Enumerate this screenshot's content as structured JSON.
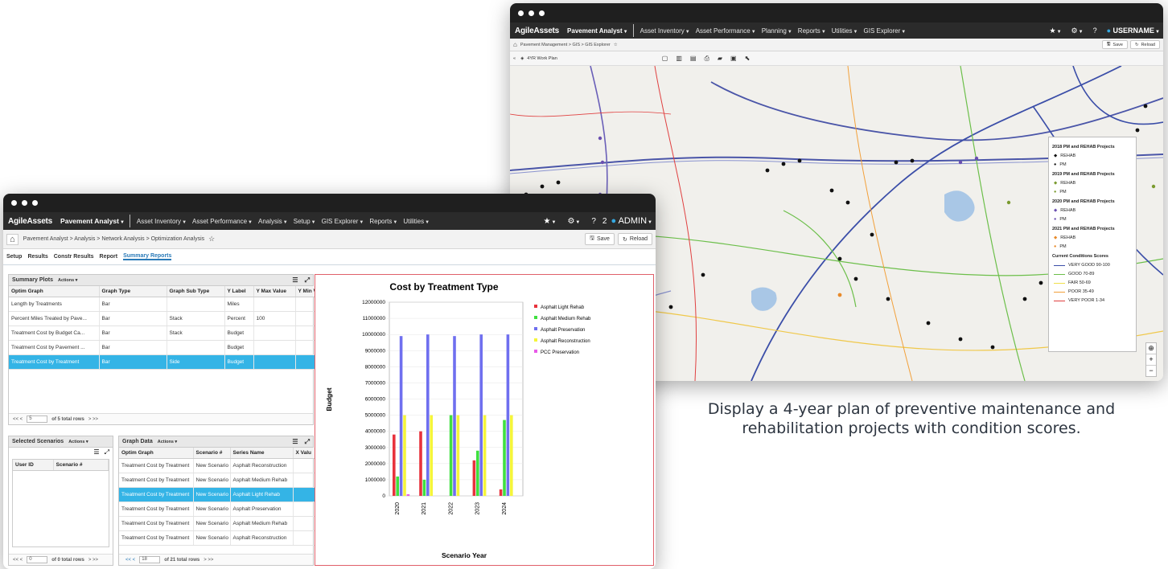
{
  "map_window": {
    "nav": {
      "logo": "AgileAssets",
      "app": "Pavement Analyst",
      "menus": [
        "Asset Inventory",
        "Asset Performance",
        "Planning",
        "Reports",
        "Utilities",
        "GIS Explorer"
      ],
      "user": "USERNAME"
    },
    "breadcrumb": "Pavement Management > GIS > GIS Explorer",
    "save_label": "Save",
    "reload_label": "Reload",
    "layer_name": "4YR Work Plan",
    "legend": {
      "groups": [
        {
          "title": "2018 PM and REHAB Projects",
          "items": [
            "REHAB",
            "PM"
          ],
          "colors": [
            "#111111",
            "#111111"
          ]
        },
        {
          "title": "2019 PM and REHAB Projects",
          "items": [
            "REHAB",
            "PM"
          ],
          "colors": [
            "#7a9a2e",
            "#7a9a2e"
          ]
        },
        {
          "title": "2020 PM and REHAB Projects",
          "items": [
            "REHAB",
            "PM"
          ],
          "colors": [
            "#6a4fb0",
            "#6a4fb0"
          ]
        },
        {
          "title": "2021 PM and REHAB Projects",
          "items": [
            "REHAB",
            "PM"
          ],
          "colors": [
            "#e88a2a",
            "#e88a2a"
          ]
        }
      ],
      "conditions_title": "Current Conditions Scores",
      "conditions": [
        {
          "label": "VERY GOOD 90-100",
          "color": "#3b4ea8"
        },
        {
          "label": "GOOD 70-89",
          "color": "#6cbf4a"
        },
        {
          "label": "FAIR 50-69",
          "color": "#f0e04a"
        },
        {
          "label": "POOR 35-49",
          "color": "#f2a03a"
        },
        {
          "label": "VERY POOR 1-34",
          "color": "#e04040"
        }
      ]
    }
  },
  "analysis_window": {
    "nav": {
      "logo": "AgileAssets",
      "app": "Pavement Analyst",
      "menus": [
        "Asset Inventory",
        "Asset Performance",
        "Analysis",
        "Setup",
        "GIS Explorer",
        "Reports",
        "Utilities"
      ],
      "notification_count": "2",
      "user": "ADMIN"
    },
    "breadcrumb": "Pavement Analyst > Analysis > Network Analysis > Optimization Analysis",
    "save_label": "Save",
    "reload_label": "Reload",
    "tabs": [
      "Setup",
      "Results",
      "Constr Results",
      "Report",
      "Summary Reports"
    ],
    "active_tab": "Summary Reports",
    "summary_plots": {
      "title": "Summary Plots",
      "actions": "Actions",
      "columns": [
        "Optim Graph",
        "Graph Type",
        "Graph Sub Type",
        "Y Label",
        "Y Max Value",
        "Y Min V"
      ],
      "rows": [
        [
          "Length by Treatments",
          "Bar",
          "",
          "Miles",
          "",
          ""
        ],
        [
          "Percent Miles Treated by Pave...",
          "Bar",
          "Stack",
          "Percent",
          "100",
          ""
        ],
        [
          "Treatment Cost by Budget Ca...",
          "Bar",
          "Stack",
          "Budget",
          "",
          ""
        ],
        [
          "Treatment Cost by Pavement ...",
          "Bar",
          "",
          "Budget",
          "",
          ""
        ],
        [
          "Treatment Cost by Treatment",
          "Bar",
          "Side",
          "Budget",
          "",
          ""
        ]
      ],
      "selected_row": 4,
      "pager_value": "5",
      "pager_text": "of 5 total rows"
    },
    "selected_scenarios": {
      "title": "Selected Scenarios",
      "actions": "Actions",
      "columns": [
        "User ID",
        "Scenario #"
      ],
      "pager_value": "0",
      "pager_text": "of 0 total rows"
    },
    "graph_data": {
      "title": "Graph Data",
      "actions": "Actions",
      "columns": [
        "Optim Graph",
        "Scenario #",
        "Series Name",
        "X Valu"
      ],
      "rows": [
        [
          "Treatment Cost by Treatment",
          "New Scenario",
          "Asphalt Reconstruction"
        ],
        [
          "Treatment Cost by Treatment",
          "New Scenario",
          "Asphalt Medium Rehab"
        ],
        [
          "Treatment Cost by Treatment",
          "New Scenario",
          "Asphalt Light Rehab"
        ],
        [
          "Treatment Cost by Treatment",
          "New Scenario",
          "Asphalt Preservation"
        ],
        [
          "Treatment Cost by Treatment",
          "New Scenario",
          "Asphalt Medium Rehab"
        ],
        [
          "Treatment Cost by Treatment",
          "New Scenario",
          "Asphalt Reconstruction"
        ]
      ],
      "selected_row": 2,
      "pager_value": "18",
      "pager_text": "of 21 total rows"
    }
  },
  "caption": "Display a 4-year plan of preventive maintenance and rehabilitation projects with condition scores.",
  "chart_data": {
    "type": "bar",
    "title": "Cost by Treatment Type",
    "xlabel": "Scenario Year",
    "ylabel": "Budget",
    "ylim": [
      0,
      12000000
    ],
    "yticks": [
      "0",
      "1000000",
      "2000000",
      "3000000",
      "4000000",
      "5000000",
      "6000000",
      "7000000",
      "8000000",
      "9000000",
      "10000000",
      "11000000",
      "12000000"
    ],
    "categories": [
      "2020",
      "2021",
      "2022",
      "2023",
      "2024"
    ],
    "legend_position": "right",
    "series": [
      {
        "name": "Asphalt Light Rehab",
        "color": "#e8323c",
        "values": [
          3800000,
          4000000,
          0,
          2200000,
          400000
        ]
      },
      {
        "name": "Asphalt Medium Rehab",
        "color": "#3fe03f",
        "values": [
          1200000,
          1000000,
          5000000,
          2800000,
          4700000
        ]
      },
      {
        "name": "Asphalt Preservation",
        "color": "#6f6fef",
        "values": [
          9900000,
          10000000,
          9900000,
          10000000,
          10000000
        ]
      },
      {
        "name": "Asphalt Reconstruction",
        "color": "#f5f53a",
        "values": [
          5000000,
          5000000,
          5000000,
          5000000,
          5000000
        ]
      },
      {
        "name": "PCC Preservation",
        "color": "#e85ae8",
        "values": [
          100000,
          0,
          0,
          0,
          0
        ]
      }
    ]
  }
}
